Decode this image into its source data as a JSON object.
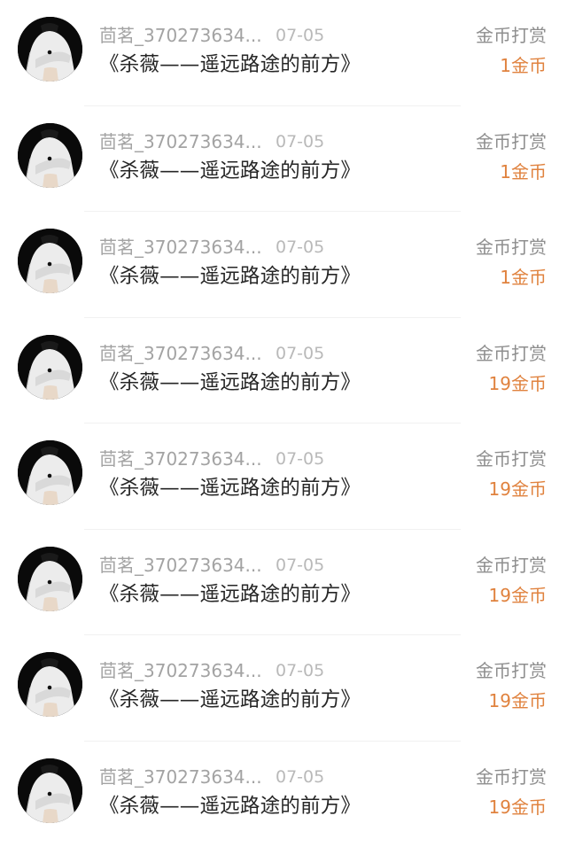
{
  "rewards": [
    {
      "username": "茴茗_370273634...",
      "date": "07-05",
      "title": "《杀薇——遥远路途的前方》",
      "reward_type": "金币打赏",
      "amount": "1金币"
    },
    {
      "username": "茴茗_370273634...",
      "date": "07-05",
      "title": "《杀薇——遥远路途的前方》",
      "reward_type": "金币打赏",
      "amount": "1金币"
    },
    {
      "username": "茴茗_370273634...",
      "date": "07-05",
      "title": "《杀薇——遥远路途的前方》",
      "reward_type": "金币打赏",
      "amount": "1金币"
    },
    {
      "username": "茴茗_370273634...",
      "date": "07-05",
      "title": "《杀薇——遥远路途的前方》",
      "reward_type": "金币打赏",
      "amount": "19金币"
    },
    {
      "username": "茴茗_370273634...",
      "date": "07-05",
      "title": "《杀薇——遥远路途的前方》",
      "reward_type": "金币打赏",
      "amount": "19金币"
    },
    {
      "username": "茴茗_370273634...",
      "date": "07-05",
      "title": "《杀薇——遥远路途的前方》",
      "reward_type": "金币打赏",
      "amount": "19金币"
    },
    {
      "username": "茴茗_370273634...",
      "date": "07-05",
      "title": "《杀薇——遥远路途的前方》",
      "reward_type": "金币打赏",
      "amount": "19金币"
    },
    {
      "username": "茴茗_370273634...",
      "date": "07-05",
      "title": "《杀薇——遥远路途的前方》",
      "reward_type": "金币打赏",
      "amount": "19金币"
    }
  ],
  "colors": {
    "amount": "#e0823e",
    "username": "#a3a3a3",
    "title": "#262626",
    "reward_type": "#8e8e8e"
  },
  "icons": {
    "avatar": "user-avatar-photo"
  }
}
